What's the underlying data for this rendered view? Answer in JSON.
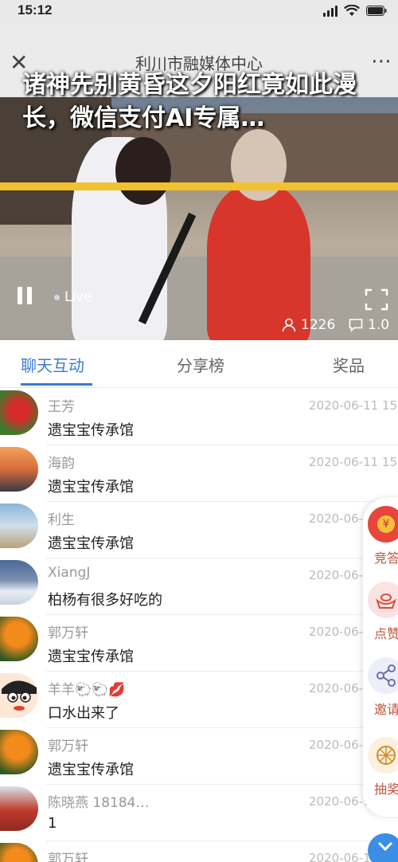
{
  "status": {
    "time": "15:12"
  },
  "header": {
    "title": "利川市融媒体中心",
    "close_icon": "close-icon",
    "more_icon": "more-icon"
  },
  "video": {
    "headline": "诸神先别黄昏这夕阳红竟如此漫长，微信支付AI专属…",
    "live_label": "Live",
    "viewers": "1226",
    "comments": "1.0"
  },
  "tabs": [
    {
      "label": "聊天互动",
      "active": true
    },
    {
      "label": "分享榜",
      "active": false
    },
    {
      "label": "奖品",
      "active": false
    }
  ],
  "messages": [
    {
      "user": "王芳",
      "text": "遗宝宝传承馆",
      "time": "2020-06-11 15:"
    },
    {
      "user": "海韵",
      "text": "遗宝宝传承馆",
      "time": "2020-06-11 15:"
    },
    {
      "user": "利生",
      "text": "遗宝宝传承馆",
      "time": "2020-06-1"
    },
    {
      "user": "XiangJ",
      "text": "柏杨有很多好吃的",
      "time": "2020-06-1"
    },
    {
      "user": "郭万轩",
      "text": "遗宝宝传承馆",
      "time": "2020-06-1"
    },
    {
      "user": "羊羊🐑🐑💋",
      "text": "口水出来了",
      "time": "2020-06-1"
    },
    {
      "user": "郭万轩",
      "text": "遗宝宝传承馆",
      "time": "2020-06-1"
    },
    {
      "user": "陈晓燕 18184…",
      "text": "1",
      "time": "2020-06-1"
    },
    {
      "user": "郭万轩",
      "text": "",
      "time": "2020-06-1"
    }
  ],
  "side_actions": [
    {
      "label": "竞答",
      "icon": "yuan-icon"
    },
    {
      "label": "点赞",
      "icon": "ingot-icon"
    },
    {
      "label": "邀请",
      "icon": "share-icon"
    },
    {
      "label": "抽奖",
      "icon": "wheel-icon"
    }
  ],
  "colors": {
    "accent": "#3a7bd5",
    "headline_bar": "#f2c12e",
    "side_label": "#c0553a"
  }
}
